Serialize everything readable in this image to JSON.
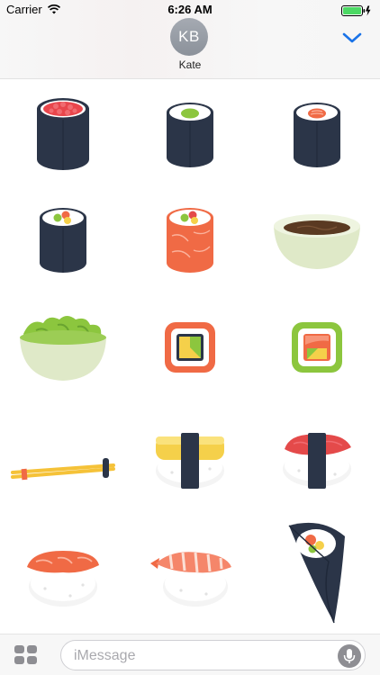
{
  "status_bar": {
    "carrier": "Carrier",
    "time": "6:26 AM"
  },
  "header": {
    "avatar_initials": "KB",
    "contact_name": "Kate"
  },
  "stickers": [
    {
      "name": "roe-roll"
    },
    {
      "name": "avocado-roll"
    },
    {
      "name": "salmon-maki-roll"
    },
    {
      "name": "california-roll"
    },
    {
      "name": "salmon-wrapped-roll"
    },
    {
      "name": "soy-sauce-bowl"
    },
    {
      "name": "wasabi-bowl"
    },
    {
      "name": "orange-square-roll"
    },
    {
      "name": "green-square-roll"
    },
    {
      "name": "chopsticks"
    },
    {
      "name": "tamago-nigiri"
    },
    {
      "name": "tuna-nigiri"
    },
    {
      "name": "salmon-nigiri"
    },
    {
      "name": "shrimp-nigiri"
    },
    {
      "name": "temaki-hand-roll"
    }
  ],
  "input": {
    "placeholder": "iMessage"
  },
  "colors": {
    "nori": "#2b3548",
    "rice": "#ffffff",
    "salmon": "#f06a45",
    "tuna": "#e44a4a",
    "avocado": "#8cc63e",
    "tamago": "#f5d04a",
    "bowl": "#dfe9c8",
    "ios_blue": "#1a73e8"
  }
}
